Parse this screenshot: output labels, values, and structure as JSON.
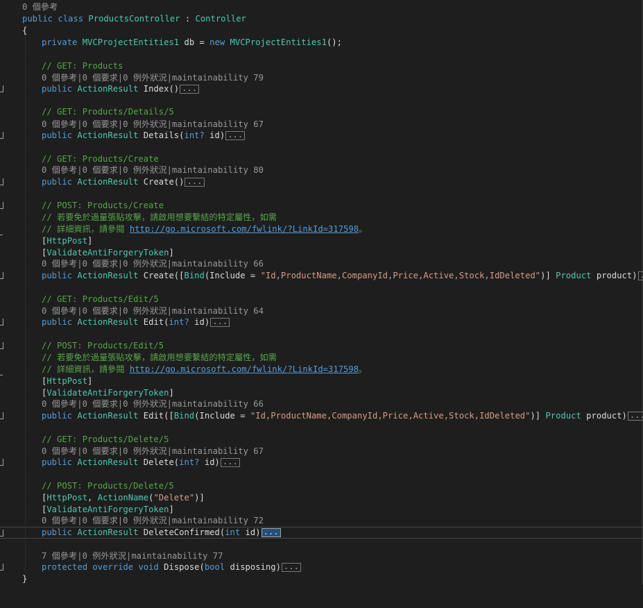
{
  "lens": {
    "class_refs": "0 個參考",
    "m_index": "0 個參考|0 個要求|0 例外狀況|maintainability 79",
    "m_details": "0 個參考|0 個要求|0 例外狀況|maintainability 67",
    "m_create": "0 個參考|0 個要求|0 例外狀況|maintainability 80",
    "m_create_post": "0 個參考|0 個要求|0 例外狀況|maintainability 66",
    "m_edit": "0 個參考|0 個要求|0 例外狀況|maintainability 64",
    "m_edit_post": "0 個參考|0 個要求|0 例外狀況|maintainability 66",
    "m_delete": "0 個參考|0 個要求|0 例外狀況|maintainability 67",
    "m_delete_confirmed": "0 個參考|0 個要求|0 例外狀況|maintainability 72",
    "m_dispose": "7 個參考|0 例外狀況|maintainability 77"
  },
  "tok": {
    "public": "public",
    "class": "class",
    "private": "private",
    "new": "new",
    "protected": "protected",
    "override": "override",
    "void": "void",
    "bool": "bool",
    "int": "int",
    "int_q": "int?",
    "controller_name": "ProductsController",
    "colon": " : ",
    "controller_base": "Controller",
    "open_brace": "{",
    "close_brace": "}",
    "entities": "MVCProjectEntities1",
    "db_decl": " db = ",
    "ctor_end": "();",
    "action_result": "ActionResult",
    "product_type": "Product",
    "product_param": " product)",
    "bind": "Bind",
    "http_post": "HttpPost",
    "validate_token": "ValidateAntiForgeryToken",
    "action_name": "ActionName",
    "delete_str": "\"Delete\"",
    "bind_str_create": "\"Id,ProductName,CompanyId,Price,Active,Stock,IdDeleted\"",
    "bind_str_edit": "\"Id,ProductName,CompanyId,Price,Active,Stock,IdDeleted\""
  },
  "methods": {
    "index": "Index()",
    "details": "Details(",
    "create": "Create()",
    "create_post": "Create([",
    "edit": "Edit(",
    "edit_post": "Edit([",
    "delete": "Delete(",
    "delete_confirmed": "DeleteConfirmed(",
    "dispose": "Dispose(",
    "id_close": " id)",
    "disposing_close": " disposing)",
    "include_eq": "(Include = ",
    "close_bracket": ")] ",
    "attr_open": "[",
    "attr_close": "]",
    "attr_open_comma": ", ",
    "paren_open": "(",
    "paren_close": ")]"
  },
  "comments": {
    "get_products": "// GET: Products",
    "get_details": "// GET: Products/Details/5",
    "get_create": "// GET: Products/Create",
    "post_create": "// POST: Products/Create",
    "overpost_warn": "// 若要免於過量張貼攻擊，請啟用想要繫結的特定屬性，如需",
    "detail_info": "// 詳細資訊，請參閱 ",
    "link": "http://go.microsoft.com/fwlink/?LinkId=317598",
    "period": "。",
    "get_edit": "// GET: Products/Edit/5",
    "post_edit": "// POST: Products/Edit/5",
    "get_delete": "// GET: Products/Delete/5",
    "post_delete": "// POST: Products/Delete/5"
  },
  "collapsed": "...",
  "colors": {
    "background": "#1e1e1e",
    "keyword": "#569cd6",
    "type": "#4ec9b0",
    "comment": "#57a64a",
    "string": "#d69d85",
    "codelens": "#999999",
    "selection": "#264f78"
  }
}
